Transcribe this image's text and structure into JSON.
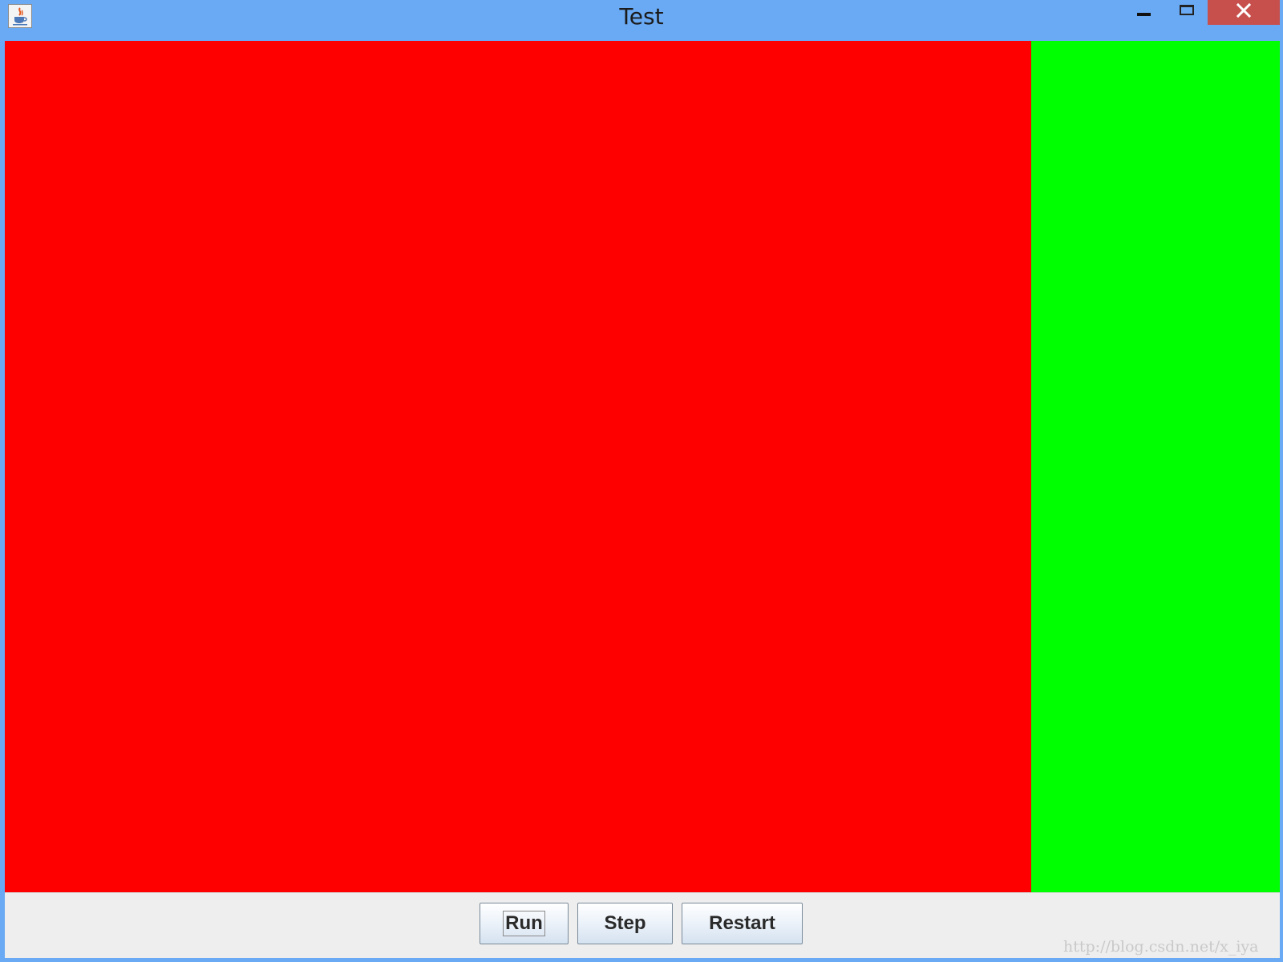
{
  "window": {
    "title": "Test"
  },
  "titlebar_controls": {
    "minimize_icon": "minimize-icon",
    "maximize_icon": "maximize-icon",
    "close_icon": "close-icon",
    "close_glyph": "✕"
  },
  "panels": {
    "left_color": "#ff0000",
    "right_color": "#00ff00"
  },
  "buttons": {
    "run_label": "Run",
    "step_label": "Step",
    "restart_label": "Restart"
  },
  "watermark": {
    "text": "http://blog.csdn.net/x_iya"
  },
  "colors": {
    "titlebar": "#6aa9f3",
    "close_button": "#c7504d"
  }
}
